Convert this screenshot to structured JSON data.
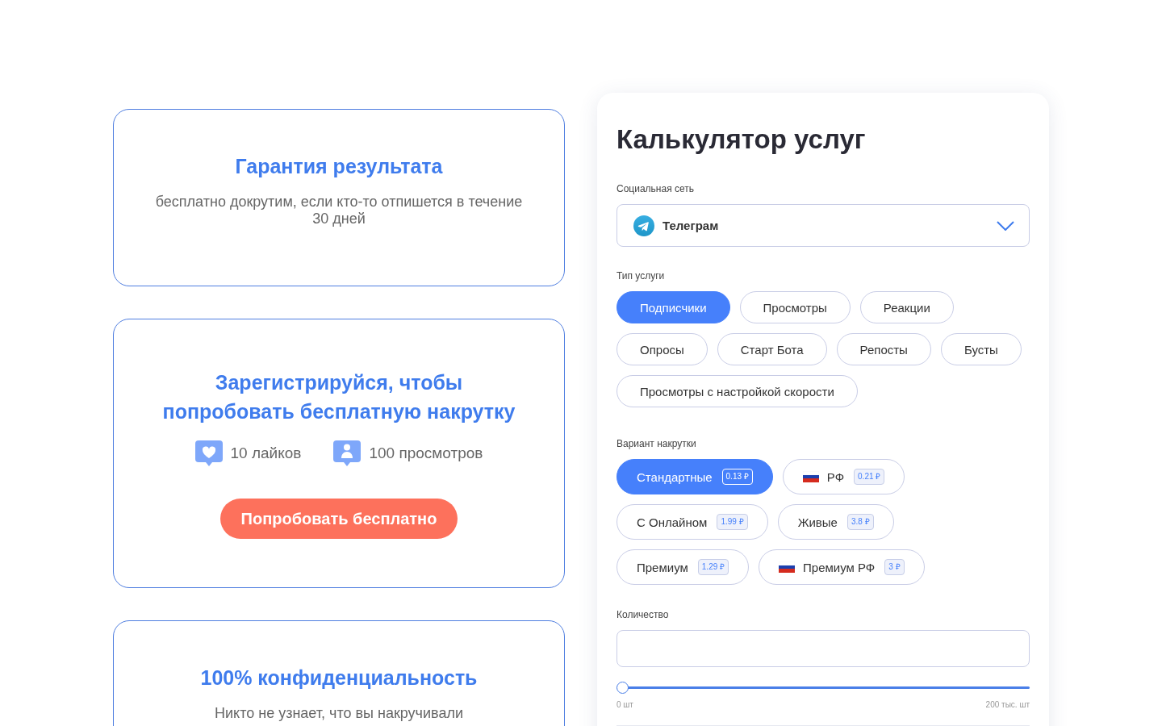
{
  "cards": [
    {
      "kind": "text",
      "title": "Гарантия результата",
      "text": "бесплатно докрутим, если кто-то отпишется в течение 30 дней"
    },
    {
      "kind": "promo",
      "title": "Зарегистрируйся, чтобы попробовать бесплатную накрутку",
      "perks": [
        {
          "kind": "like",
          "label": "10 лайков"
        },
        {
          "kind": "view",
          "label": "100 просмотров"
        }
      ],
      "button": "Попробовать бесплатно"
    },
    {
      "kind": "text",
      "title": "100% конфиденциальность",
      "text": "Никто не узнает, что вы накручивали"
    }
  ],
  "calculator": {
    "title": "Калькулятор услуг",
    "network": {
      "label": "Социальная сеть",
      "value": "Телеграм"
    },
    "service_type": {
      "label": "Тип услуги",
      "options": [
        {
          "label": "Подписчики",
          "selected": true
        },
        {
          "label": "Просмотры",
          "selected": false
        },
        {
          "label": "Реакции",
          "selected": false
        },
        {
          "label": "Опросы",
          "selected": false
        },
        {
          "label": "Старт Бота",
          "selected": false
        },
        {
          "label": "Репосты",
          "selected": false
        },
        {
          "label": "Бусты",
          "selected": false
        },
        {
          "label": "Просмотры с настройкой скорости",
          "selected": false
        }
      ]
    },
    "variant": {
      "label": "Вариант накрутки",
      "options": [
        {
          "label": "Стандартные",
          "price": "0.13 ₽",
          "flag": false,
          "selected": true
        },
        {
          "label": "РФ",
          "price": "0.21 ₽",
          "flag": true,
          "selected": false
        },
        {
          "label": "С Онлайном",
          "price": "1.99 ₽",
          "flag": false,
          "selected": false
        },
        {
          "label": "Живые",
          "price": "3.8 ₽",
          "flag": false,
          "selected": false
        },
        {
          "label": "Премиум",
          "price": "1.29 ₽",
          "flag": false,
          "selected": false
        },
        {
          "label": "Премиум РФ",
          "price": "3 ₽",
          "flag": true,
          "selected": false
        }
      ]
    },
    "quantity": {
      "label": "Количество",
      "slider": {
        "level": 0,
        "min_label": "0 шт",
        "max_label": "200 тыс. шт"
      }
    }
  }
}
